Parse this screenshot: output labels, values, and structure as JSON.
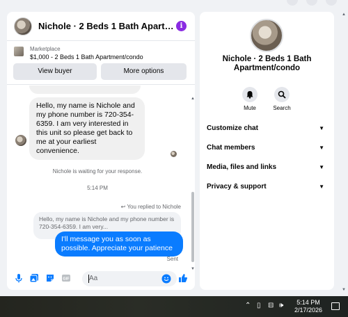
{
  "colors": {
    "accent": "#0a7cff",
    "info_icon": "#8a2be2",
    "panel_bg": "#ffffff",
    "page_bg": "#f0f2f5"
  },
  "chat": {
    "title": "Nichole · 2 Beds 1 Bath Apartment/condo",
    "marketplace": {
      "label": "Marketplace",
      "description": "$1,000 - 2 Beds 1 Bath Apartment/condo",
      "view_buyer": "View buyer",
      "more_options": "More options"
    },
    "messages": {
      "incoming": "Hello, my name is Nichole and my phone number is 720-354-6359. I am very interested in this unit so please get back to me at your earliest convenience.",
      "waiting": "Nichole is waiting for your response.",
      "time": "5:14 PM",
      "replied_to": "You replied to Nichole",
      "quoted": "Hello, my name is Nichole and my phone number is 720-354-6359. I am very...",
      "outgoing": "I'll message you as soon as possible. Appreciate your patience",
      "sent_status": "Sent"
    },
    "composer": {
      "placeholder": "Aa",
      "icons": [
        "microphone-icon",
        "image-icon",
        "sticker-icon",
        "gif-icon",
        "emoji-icon",
        "thumbs-up-icon"
      ],
      "gif_label": "GIF"
    }
  },
  "info_panel": {
    "name": "Nichole · 2 Beds 1 Bath Apartment/condo",
    "actions": [
      {
        "label": "Mute",
        "icon": "bell-icon"
      },
      {
        "label": "Search",
        "icon": "search-icon"
      }
    ],
    "sections": [
      "Customize chat",
      "Chat members",
      "Media, files and links",
      "Privacy & support"
    ]
  },
  "taskbar": {
    "time": "5:14 PM",
    "date": "2/17/2026"
  }
}
